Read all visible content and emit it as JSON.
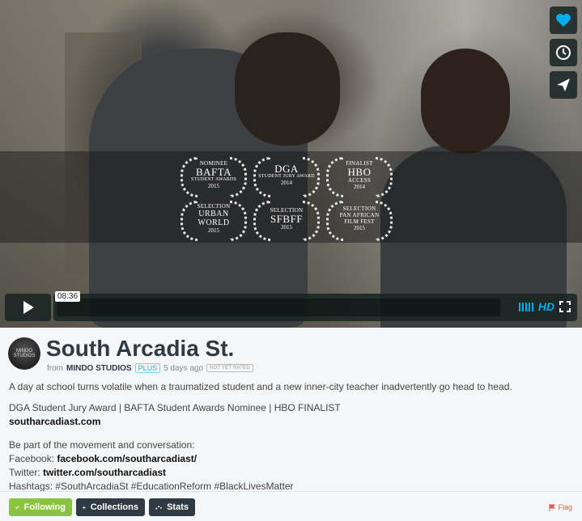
{
  "player": {
    "time": "08:36",
    "hd_label": "HD",
    "laurels": [
      {
        "top": "NOMINEE",
        "main": "BAFTA",
        "sub": "STUDENT AWARDS",
        "year": "2015"
      },
      {
        "top": "",
        "main": "DGA",
        "sub": "STUDENT JURY AWARD",
        "year": "2014"
      },
      {
        "top": "FINALIST",
        "main": "HBO",
        "sub": "ACCESS",
        "year": "2014"
      },
      {
        "top": "SELECTION",
        "main": "URBAN WORLD",
        "sub": "",
        "year": "2015"
      },
      {
        "top": "SELECTION",
        "main": "SFBFF",
        "sub": "",
        "year": "2015"
      },
      {
        "top": "SELECTION",
        "main": "PAN AFRICAN",
        "sub": "FILM FEST",
        "year": "2015"
      }
    ],
    "icons": {
      "like": "heart-icon",
      "later": "clock-icon",
      "share": "paper-plane-icon",
      "play": "play-icon",
      "fullscreen": "fullscreen-icon",
      "volume": "volume-bars-icon"
    },
    "accent": "#00adef"
  },
  "video": {
    "avatar_text": "MINDO STUDIOS",
    "title": "South Arcadia St.",
    "from_label": "from",
    "studio": "MINDO STUDIOS",
    "plus_badge": "PLUS",
    "posted": "5 days ago",
    "rating": "NOT YET RATED"
  },
  "description": {
    "summary": "A day at school turns volatile when a traumatized student and a new inner-city teacher inadvertently go head to head.",
    "awards": "DGA Student Jury Award | BAFTA Student Awards Nominee | HBO FINALIST",
    "website": "southarcadiast.com",
    "cta": "Be part of the movement and conversation:",
    "facebook_label": "Facebook:",
    "facebook_link": "facebook.com/southarcadiast/",
    "twitter_label": "Twitter:",
    "twitter_link": "twitter.com/southarcadiast",
    "hashtags": "Hashtags: #SouthArcadiaSt #EducationReform #BlackLivesMatter"
  },
  "actions": {
    "following": "Following",
    "collections": "Collections",
    "stats": "Stats",
    "flag": "Flag",
    "following_color": "#8ac43f"
  }
}
